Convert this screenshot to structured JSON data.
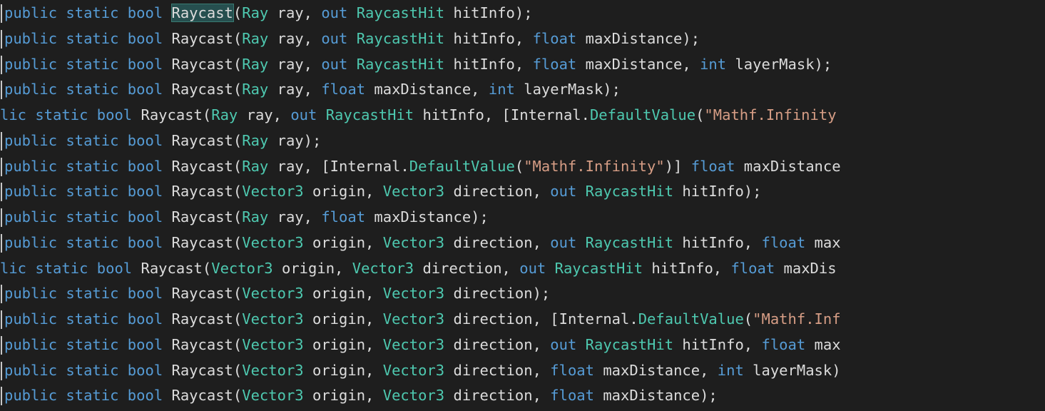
{
  "colors": {
    "background": "#1e1e1e",
    "keyword": "#569cd6",
    "type": "#4ec9b0",
    "string": "#d69d85",
    "identifier": "#dcdcdc",
    "highlight": "#264f4f"
  },
  "lines": [
    {
      "indent": "full",
      "tokens": [
        [
          "kw",
          "public static bool "
        ],
        [
          "hl",
          "Raycast"
        ],
        [
          "id",
          "("
        ],
        [
          "ty",
          "Ray"
        ],
        [
          "id",
          " ray, "
        ],
        [
          "kw",
          "out "
        ],
        [
          "ty",
          "RaycastHit"
        ],
        [
          "id",
          " hitInfo);"
        ]
      ]
    },
    {
      "indent": "full",
      "tokens": [
        [
          "kw",
          "public static bool "
        ],
        [
          "id",
          "Raycast("
        ],
        [
          "ty",
          "Ray"
        ],
        [
          "id",
          " ray, "
        ],
        [
          "kw",
          "out "
        ],
        [
          "ty",
          "RaycastHit"
        ],
        [
          "id",
          " hitInfo, "
        ],
        [
          "kw",
          "float"
        ],
        [
          "id",
          " maxDistance);"
        ]
      ]
    },
    {
      "indent": "full",
      "tokens": [
        [
          "kw",
          "public static bool "
        ],
        [
          "id",
          "Raycast("
        ],
        [
          "ty",
          "Ray"
        ],
        [
          "id",
          " ray, "
        ],
        [
          "kw",
          "out "
        ],
        [
          "ty",
          "RaycastHit"
        ],
        [
          "id",
          " hitInfo, "
        ],
        [
          "kw",
          "float"
        ],
        [
          "id",
          " maxDistance, "
        ],
        [
          "kw",
          "int"
        ],
        [
          "id",
          " layerMask);"
        ]
      ]
    },
    {
      "indent": "full",
      "tokens": [
        [
          "kw",
          "public static bool "
        ],
        [
          "id",
          "Raycast("
        ],
        [
          "ty",
          "Ray"
        ],
        [
          "id",
          " ray, "
        ],
        [
          "kw",
          "float"
        ],
        [
          "id",
          " maxDistance, "
        ],
        [
          "kw",
          "int"
        ],
        [
          "id",
          " layerMask);"
        ]
      ]
    },
    {
      "indent": "cut",
      "tokens": [
        [
          "kw",
          "lic static bool "
        ],
        [
          "id",
          "Raycast("
        ],
        [
          "ty",
          "Ray"
        ],
        [
          "id",
          " ray, "
        ],
        [
          "kw",
          "out "
        ],
        [
          "ty",
          "RaycastHit"
        ],
        [
          "id",
          " hitInfo, [Internal."
        ],
        [
          "ty",
          "DefaultValue"
        ],
        [
          "id",
          "("
        ],
        [
          "st",
          "\"Mathf.Infinity"
        ]
      ]
    },
    {
      "indent": "full",
      "tokens": [
        [
          "kw",
          "public static bool "
        ],
        [
          "id",
          "Raycast("
        ],
        [
          "ty",
          "Ray"
        ],
        [
          "id",
          " ray);"
        ]
      ]
    },
    {
      "indent": "full",
      "tokens": [
        [
          "kw",
          "public static bool "
        ],
        [
          "id",
          "Raycast("
        ],
        [
          "ty",
          "Ray"
        ],
        [
          "id",
          " ray, [Internal."
        ],
        [
          "ty",
          "DefaultValue"
        ],
        [
          "id",
          "("
        ],
        [
          "st",
          "\"Mathf.Infinity\""
        ],
        [
          "id",
          ")] "
        ],
        [
          "kw",
          "float"
        ],
        [
          "id",
          " maxDistance"
        ]
      ]
    },
    {
      "indent": "full",
      "tokens": [
        [
          "kw",
          "public static bool "
        ],
        [
          "id",
          "Raycast("
        ],
        [
          "ty",
          "Vector3"
        ],
        [
          "id",
          " origin, "
        ],
        [
          "ty",
          "Vector3"
        ],
        [
          "id",
          " direction, "
        ],
        [
          "kw",
          "out "
        ],
        [
          "ty",
          "RaycastHit"
        ],
        [
          "id",
          " hitInfo);"
        ]
      ]
    },
    {
      "indent": "full",
      "tokens": [
        [
          "kw",
          "public static bool "
        ],
        [
          "id",
          "Raycast("
        ],
        [
          "ty",
          "Ray"
        ],
        [
          "id",
          " ray, "
        ],
        [
          "kw",
          "float"
        ],
        [
          "id",
          " maxDistance);"
        ]
      ]
    },
    {
      "indent": "full",
      "tokens": [
        [
          "kw",
          "public static bool "
        ],
        [
          "id",
          "Raycast("
        ],
        [
          "ty",
          "Vector3"
        ],
        [
          "id",
          " origin, "
        ],
        [
          "ty",
          "Vector3"
        ],
        [
          "id",
          " direction, "
        ],
        [
          "kw",
          "out "
        ],
        [
          "ty",
          "RaycastHit"
        ],
        [
          "id",
          " hitInfo, "
        ],
        [
          "kw",
          "float"
        ],
        [
          "id",
          " max"
        ]
      ]
    },
    {
      "indent": "cut",
      "tokens": [
        [
          "kw",
          "lic static bool "
        ],
        [
          "id",
          "Raycast("
        ],
        [
          "ty",
          "Vector3"
        ],
        [
          "id",
          " origin, "
        ],
        [
          "ty",
          "Vector3"
        ],
        [
          "id",
          " direction, "
        ],
        [
          "kw",
          "out "
        ],
        [
          "ty",
          "RaycastHit"
        ],
        [
          "id",
          " hitInfo, "
        ],
        [
          "kw",
          "float"
        ],
        [
          "id",
          " maxDis"
        ]
      ]
    },
    {
      "indent": "full",
      "tokens": [
        [
          "kw",
          "public static bool "
        ],
        [
          "id",
          "Raycast("
        ],
        [
          "ty",
          "Vector3"
        ],
        [
          "id",
          " origin, "
        ],
        [
          "ty",
          "Vector3"
        ],
        [
          "id",
          " direction);"
        ]
      ]
    },
    {
      "indent": "full",
      "tokens": [
        [
          "kw",
          "public static bool "
        ],
        [
          "id",
          "Raycast("
        ],
        [
          "ty",
          "Vector3"
        ],
        [
          "id",
          " origin, "
        ],
        [
          "ty",
          "Vector3"
        ],
        [
          "id",
          " direction, [Internal."
        ],
        [
          "ty",
          "DefaultValue"
        ],
        [
          "id",
          "("
        ],
        [
          "st",
          "\"Mathf.Inf"
        ]
      ]
    },
    {
      "indent": "full",
      "tokens": [
        [
          "kw",
          "public static bool "
        ],
        [
          "id",
          "Raycast("
        ],
        [
          "ty",
          "Vector3"
        ],
        [
          "id",
          " origin, "
        ],
        [
          "ty",
          "Vector3"
        ],
        [
          "id",
          " direction, "
        ],
        [
          "kw",
          "out "
        ],
        [
          "ty",
          "RaycastHit"
        ],
        [
          "id",
          " hitInfo, "
        ],
        [
          "kw",
          "float"
        ],
        [
          "id",
          " max"
        ]
      ]
    },
    {
      "indent": "full",
      "tokens": [
        [
          "kw",
          "public static bool "
        ],
        [
          "id",
          "Raycast("
        ],
        [
          "ty",
          "Vector3"
        ],
        [
          "id",
          " origin, "
        ],
        [
          "ty",
          "Vector3"
        ],
        [
          "id",
          " direction, "
        ],
        [
          "kw",
          "float"
        ],
        [
          "id",
          " maxDistance, "
        ],
        [
          "kw",
          "int"
        ],
        [
          "id",
          " layerMask)"
        ]
      ]
    },
    {
      "indent": "full",
      "tokens": [
        [
          "kw",
          "public static bool "
        ],
        [
          "id",
          "Raycast("
        ],
        [
          "ty",
          "Vector3"
        ],
        [
          "id",
          " origin, "
        ],
        [
          "ty",
          "Vector3"
        ],
        [
          "id",
          " direction, "
        ],
        [
          "kw",
          "float"
        ],
        [
          "id",
          " maxDistance);"
        ]
      ]
    }
  ]
}
